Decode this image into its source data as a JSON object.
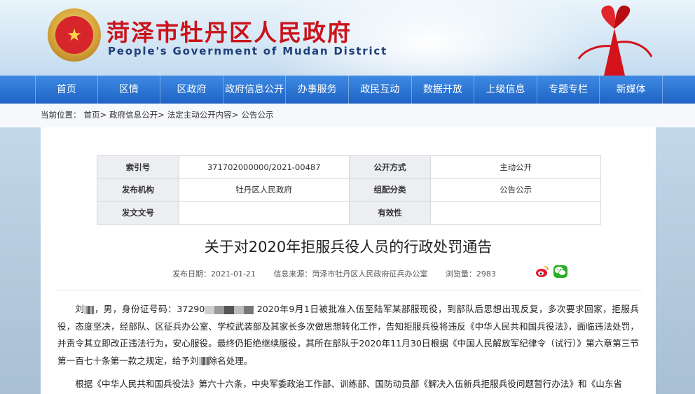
{
  "header": {
    "title": "菏泽市牡丹区人民政府",
    "subtitle": "People's Government of Mudan District"
  },
  "nav": [
    "首页",
    "区情",
    "区政府",
    "政府信息公开",
    "办事服务",
    "政民互动",
    "数据开放",
    "上级信息",
    "专题专栏",
    "新媒体"
  ],
  "breadcrumb": {
    "label": "当前位置：",
    "items": [
      "首页>",
      "政府信息公开>",
      "法定主动公开内容>",
      "公告公示"
    ]
  },
  "meta": {
    "index_label": "索引号",
    "index_value": "371702000000/2021-00487",
    "method_label": "公开方式",
    "method_value": "主动公开",
    "org_label": "发布机构",
    "org_value": "牡丹区人民政府",
    "category_label": "组配分类",
    "category_value": "公告公示",
    "docno_label": "发文文号",
    "docno_value": "",
    "validity_label": "有效性",
    "validity_value": ""
  },
  "article": {
    "title": "关于对2020年拒服兵役人员的行政处罚通告",
    "date": "发布日期：2021-01-21",
    "source": "信息来源：菏泽市牡丹区人民政府征兵办公室",
    "views": "浏览量：2983",
    "p1_a": "刘",
    "p1_b": "，男，身份证号码：37290",
    "p1_c": "2020年9月1日被批准入伍至陆军某部服现役，到部队后思想出现反复，多次要求回家，拒服兵役，态度坚决，经部队、区征兵办公室、学校武装部及其家长多次做思想转化工作，告知拒服兵役将违反《中华人民共和国兵役法》，面临违法处罚，并责令其立即改正违法行为，安心服役。最终仍拒绝继续服役，其所在部队于2020年11月30日根据《中国人民解放军纪律令（试行）》第六章第三节第一百七十条第一款之规定，给予刘",
    "p1_d": "除名处理。",
    "p2": "根据《中华人民共和国兵役法》第六十六条，中央军委政治工作部、训练部、国防动员部《解决入伍新兵拒服兵役问题暂行办法》和《山东省"
  }
}
